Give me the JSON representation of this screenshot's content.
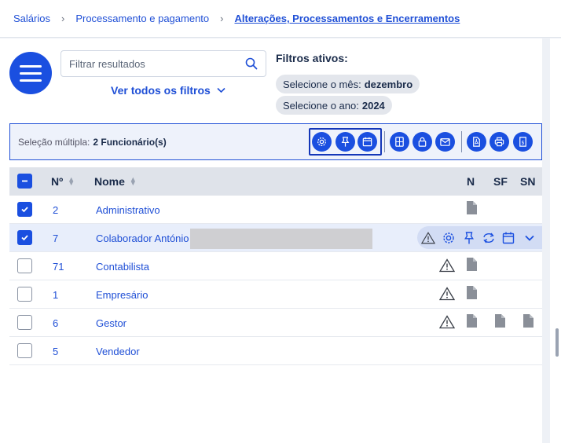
{
  "breadcrumb": {
    "items": [
      "Salários",
      "Processamento e pagamento",
      "Alterações, Processamentos e Encerramentos"
    ]
  },
  "search": {
    "placeholder": "Filtrar resultados"
  },
  "filters": {
    "view_all_label": "Ver todos os filtros",
    "active_title": "Filtros ativos:",
    "month_label": "Selecione o mês:",
    "month_value": "dezembro",
    "year_label": "Selecione o ano:",
    "year_value": "2024"
  },
  "selection": {
    "label": "Seleção múltipla:",
    "count": "2 Funcionário(s)"
  },
  "table": {
    "headers": {
      "num": "Nº",
      "name": "Nome",
      "n": "N",
      "sf": "SF",
      "sn": "SN"
    },
    "rows": [
      {
        "num": "2",
        "name": "Administrativo",
        "checked": true
      },
      {
        "num": "7",
        "name": "Colaborador António",
        "checked": true
      },
      {
        "num": "71",
        "name": "Contabilista",
        "checked": false
      },
      {
        "num": "1",
        "name": "Empresário",
        "checked": false
      },
      {
        "num": "6",
        "name": "Gestor",
        "checked": false
      },
      {
        "num": "5",
        "name": "Vendedor",
        "checked": false
      }
    ]
  },
  "colors": {
    "accent": "#1a4fe0",
    "link": "#1f4fd6",
    "header_bg": "#dfe3ea",
    "highlight_row": "#e8eefb"
  },
  "icons": [
    "menu-icon",
    "search-icon",
    "chevron-down-icon",
    "gear-icon",
    "pin-icon",
    "calendar-icon",
    "calculator-icon",
    "lock-icon",
    "mail-icon",
    "pdf-icon",
    "print-icon",
    "receipt-icon",
    "warning-icon",
    "document-icon",
    "refresh-icon"
  ]
}
